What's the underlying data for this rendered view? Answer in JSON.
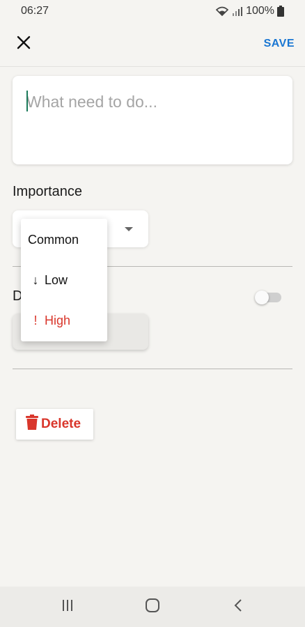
{
  "status_bar": {
    "time": "06:27",
    "battery": "100%",
    "icons": [
      "wifi-icon",
      "signal-icon",
      "battery-icon"
    ]
  },
  "app_bar": {
    "close_icon": "close-icon",
    "save_label": "SAVE"
  },
  "task": {
    "placeholder": "What need to do...",
    "value": ""
  },
  "importance": {
    "label": "Importance",
    "selected": "",
    "options": [
      {
        "glyph": "",
        "label": "Common"
      },
      {
        "glyph": "↓",
        "label": "Low"
      },
      {
        "glyph": "!",
        "label": "High"
      }
    ]
  },
  "deadline": {
    "label_partial": "D",
    "toggle_on": false
  },
  "delete": {
    "label": "Delete",
    "icon": "trash-icon"
  },
  "nav": [
    "recent-apps-icon",
    "home-icon",
    "back-icon"
  ],
  "colors": {
    "accent": "#1976d2",
    "danger": "#d9362b",
    "caret": "#1b7a5a",
    "background": "#f5f4f1"
  }
}
